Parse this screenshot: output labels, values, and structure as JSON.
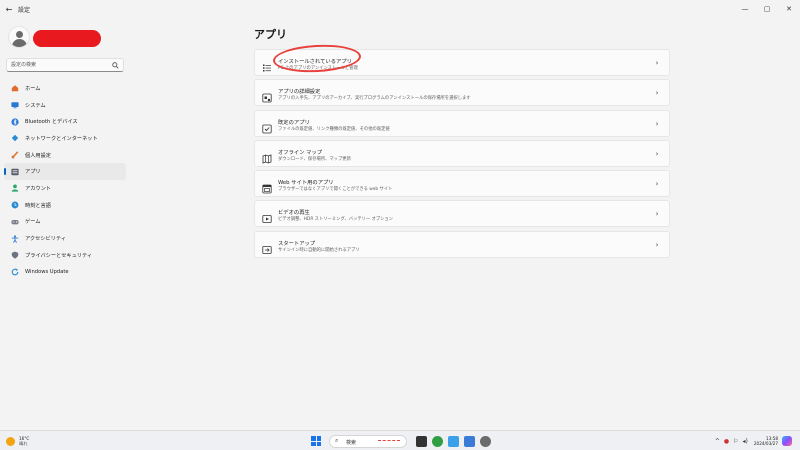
{
  "window": {
    "title": "設定",
    "back_glyph": "←",
    "minimize_glyph": "—",
    "maximize_glyph": "▢",
    "close_glyph": "✕"
  },
  "sidebar": {
    "search_placeholder": "設定の検索",
    "items": [
      {
        "label": "ホーム",
        "icon": "home-icon",
        "color": "#e06b2f"
      },
      {
        "label": "システム",
        "icon": "system-icon",
        "color": "#2a78d4"
      },
      {
        "label": "Bluetooth とデバイス",
        "icon": "bluetooth-icon",
        "color": "#2a78d4"
      },
      {
        "label": "ネットワークとインターネット",
        "icon": "network-icon",
        "color": "#2a8bd4"
      },
      {
        "label": "個人用設定",
        "icon": "brush-icon",
        "color": "#d97a3a"
      },
      {
        "label": "アプリ",
        "icon": "apps-icon",
        "color": "#555a66",
        "active": true
      },
      {
        "label": "アカウント",
        "icon": "account-icon",
        "color": "#29a86b"
      },
      {
        "label": "時刻と言語",
        "icon": "globe-clock-icon",
        "color": "#2a8bd4"
      },
      {
        "label": "ゲーム",
        "icon": "gamepad-icon",
        "color": "#7a7f8a"
      },
      {
        "label": "アクセシビリティ",
        "icon": "accessibility-icon",
        "color": "#2a78d4"
      },
      {
        "label": "プライバシーとセキュリティ",
        "icon": "shield-icon",
        "color": "#6b7280"
      },
      {
        "label": "Windows Update",
        "icon": "windows-update-icon",
        "color": "#2a8bd4"
      }
    ]
  },
  "main": {
    "title": "アプリ",
    "cards": [
      {
        "title": "インストールされているアプリ",
        "subtitle": "PC 上のアプリのアンインストールと管理",
        "icon": "installed-apps-icon"
      },
      {
        "title": "アプリの詳細設定",
        "subtitle": "アプリの入手先、アプリのアーカイブ、実行プログラムのアンインストールの保存場所を選択します",
        "icon": "advanced-apps-icon"
      },
      {
        "title": "既定のアプリ",
        "subtitle": "ファイルの既定値、リンク種類の既定値、その他の既定値",
        "icon": "default-apps-icon"
      },
      {
        "title": "オフライン マップ",
        "subtitle": "ダウンロード、保存場所、マップ更新",
        "icon": "offline-maps-icon"
      },
      {
        "title": "Web サイト用のアプリ",
        "subtitle": "ブラウザーではなくアプリで開くことができる web サイト",
        "icon": "web-apps-icon"
      },
      {
        "title": "ビデオの再生",
        "subtitle": "ビデオ調整、HDR ストリーミング、バッテリー オプション",
        "icon": "video-playback-icon"
      },
      {
        "title": "スタートアップ",
        "subtitle": "サインイン時に自動的に開始されるアプリ",
        "icon": "startup-icon"
      }
    ],
    "chevron_glyph": "›"
  },
  "taskbar": {
    "weather_temp": "16°C",
    "weather_cond": "晴れ",
    "search_label": "検索",
    "search_glyph": "⌕",
    "apps": [
      {
        "icon": "start-icon"
      },
      {
        "icon": "file-explorer-icon",
        "color": "#333333"
      },
      {
        "icon": "chrome-icon",
        "color": "#2f9e44"
      },
      {
        "icon": "photos-icon",
        "color": "#3aa0e8"
      },
      {
        "icon": "control-panel-icon",
        "color": "#3a7bd5"
      },
      {
        "icon": "settings-icon",
        "color": "#6b6b6b"
      }
    ],
    "time": "13:58",
    "date": "2024/03/27",
    "tray_chevron": "^",
    "tray_network": "⚐",
    "tray_volume": "◂)"
  }
}
